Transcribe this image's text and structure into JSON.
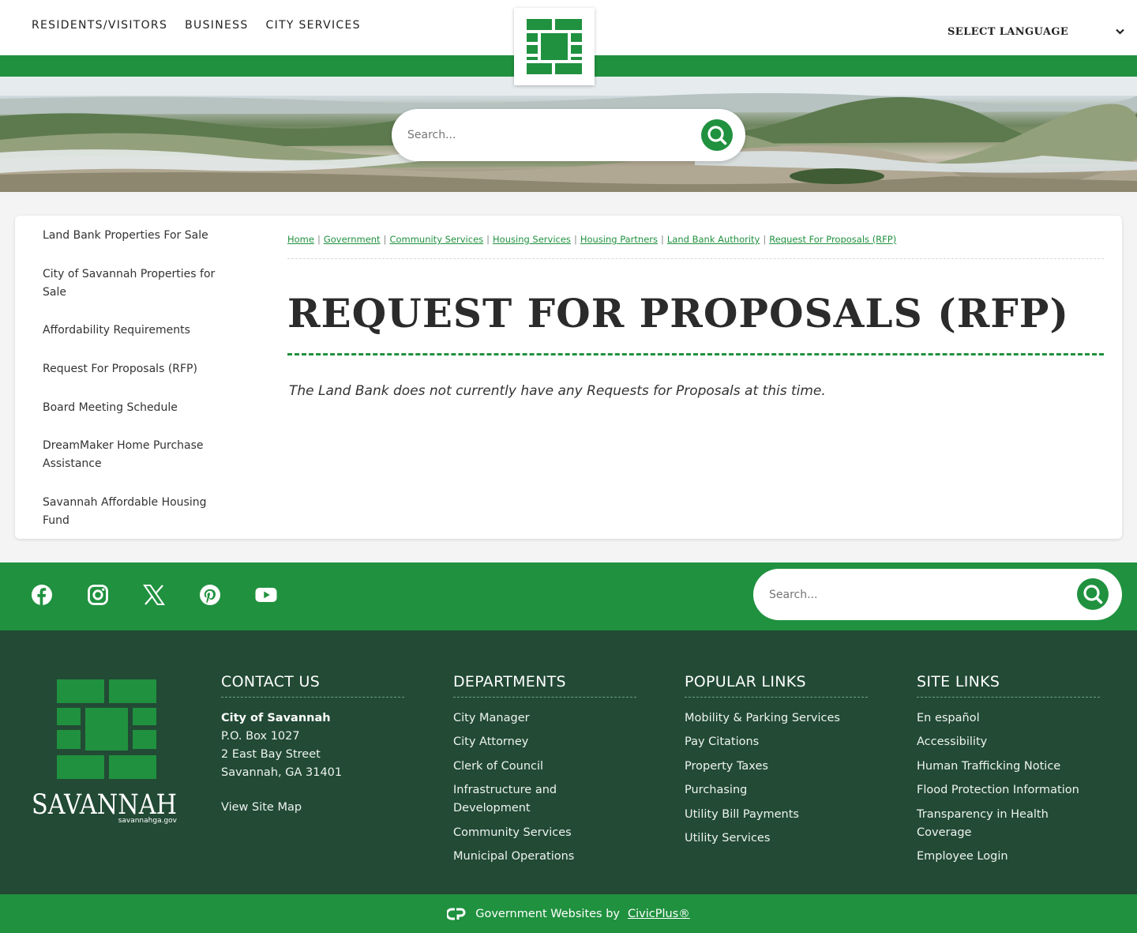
{
  "header": {
    "nav": [
      "RESIDENTS/VISITORS",
      "BUSINESS",
      "CITY SERVICES"
    ],
    "language_label": "SELECT LANGUAGE",
    "search_placeholder": "Search..."
  },
  "sidebar": {
    "items": [
      "Land Bank Properties For Sale",
      "City of Savannah Properties for Sale",
      "Affordability Requirements",
      "Request For Proposals (RFP)",
      "Board Meeting Schedule",
      "DreamMaker Home Purchase Assistance",
      "Savannah Affordable Housing Fund"
    ]
  },
  "breadcrumb": [
    "Home",
    "Government",
    "Community Services",
    "Housing Services",
    "Housing Partners",
    "Land Bank Authority",
    "Request For Proposals (RFP)"
  ],
  "main": {
    "title": "REQUEST FOR PROPOSALS (RFP)",
    "notice": "The Land Bank does not currently have any Requests for Proposals at this time."
  },
  "social": {
    "icons": [
      "facebook-icon",
      "instagram-icon",
      "x-icon",
      "pinterest-icon",
      "youtube-icon"
    ],
    "search_placeholder": "Search..."
  },
  "footer": {
    "logo_text": "SAVANNAH",
    "logo_domain": "savannahga.gov",
    "contact": {
      "heading": "CONTACT US",
      "org": "City of Savannah",
      "address": [
        "P.O. Box 1027",
        "2 East Bay Street",
        "Savannah, GA 31401"
      ],
      "sitemap": "View Site Map"
    },
    "departments": {
      "heading": "DEPARTMENTS",
      "links": [
        "City Manager",
        "City Attorney",
        "Clerk of Council",
        "Infrastructure and Development",
        "Community Services",
        "Municipal Operations"
      ]
    },
    "popular": {
      "heading": "POPULAR LINKS",
      "links": [
        "Mobility & Parking Services",
        "Pay Citations",
        "Property Taxes",
        "Purchasing",
        "Utility Bill Payments",
        "Utility Services"
      ]
    },
    "site": {
      "heading": "SITE LINKS",
      "links": [
        "En español",
        "Accessibility",
        "Human Trafficking Notice",
        "Flood Protection Information",
        "Transparency in Health Coverage",
        "Employee Login"
      ]
    },
    "credit_text": "Government Websites by",
    "credit_link": "CivicPlus®"
  },
  "colors": {
    "brand_green": "#20913f",
    "footer_dark": "#224a35"
  }
}
